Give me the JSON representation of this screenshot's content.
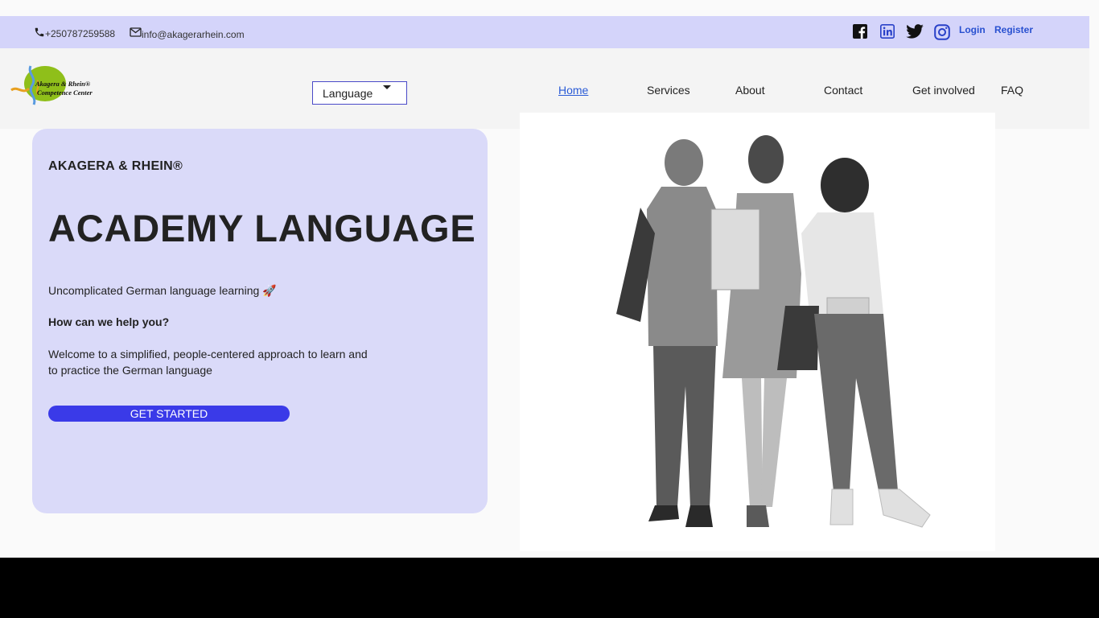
{
  "topbar": {
    "phone": "+250787259588",
    "email": "info@akagerarhein.com",
    "social": [
      "facebook",
      "linkedin",
      "twitter",
      "instagram"
    ],
    "login": "Login",
    "register": "Register"
  },
  "header": {
    "logo_line1": "Akagera & Rhein®",
    "logo_line2": "Competence Center",
    "language_label": "Language",
    "nav": [
      "Home",
      "Services",
      "About",
      "Contact",
      "Get involved",
      "FAQ"
    ],
    "active_nav": "Home"
  },
  "hero": {
    "brand": "AKAGERA & RHEIN®",
    "headline": "ACADEMY LANGUAGE",
    "tagline": "Uncomplicated German language learning 🚀",
    "help_heading": "How can we help you?",
    "welcome": "Welcome to a simplified, people-centered approach to learn and to practice the German language",
    "cta": "GET STARTED"
  },
  "colors": {
    "topbar": "#d4d4fa",
    "hero_card": "#dadaf9",
    "cta": "#3a3ae8",
    "link": "#2a5bd6"
  }
}
